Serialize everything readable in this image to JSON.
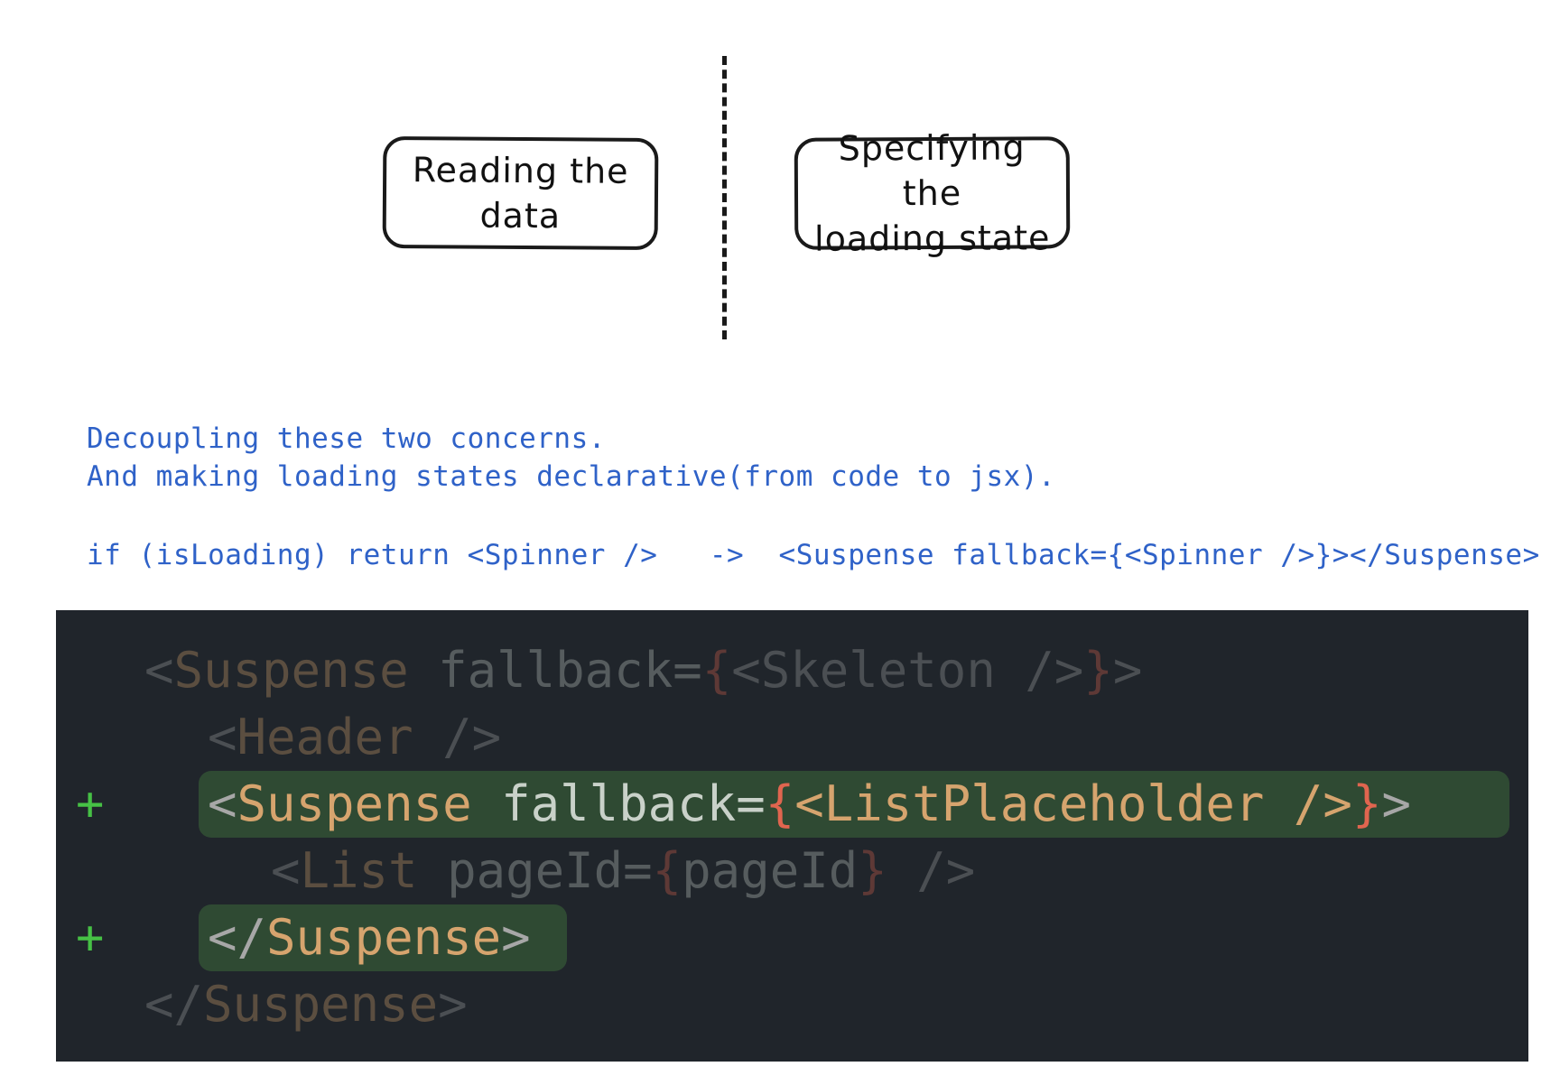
{
  "diagram": {
    "left_box": "Reading the\ndata",
    "right_box": "Specifying the\nloading state"
  },
  "notes": {
    "line1": "Decoupling these two concerns.",
    "line2": "And making loading states declarative(from code to jsx).",
    "line3": "if (isLoading) return <Spinner />   ->  <Suspense fallback={<Spinner />}></Suspense>"
  },
  "code": {
    "line1": {
      "open": "<",
      "name": "Suspense",
      "attr": " fallback=",
      "b1": "{",
      "inner": "<Skeleton />",
      "b2": "}",
      "close": ">"
    },
    "line2": {
      "open": "<",
      "name": "Header",
      "close": " />"
    },
    "line3": {
      "open": "<",
      "name": "Suspense",
      "attr": " fallback=",
      "b1": "{",
      "inner": "<ListPlaceholder />",
      "b2": "}",
      "close": ">"
    },
    "line4": {
      "open": "<",
      "name": "List",
      "attr": " pageId=",
      "b1": "{",
      "inner": "pageId",
      "b2": "}",
      "close": " />"
    },
    "line5": {
      "open": "</",
      "name": "Suspense",
      "close": ">"
    },
    "line6": {
      "open": "</",
      "name": "Suspense",
      "close": ">"
    },
    "added_marker": "+"
  }
}
